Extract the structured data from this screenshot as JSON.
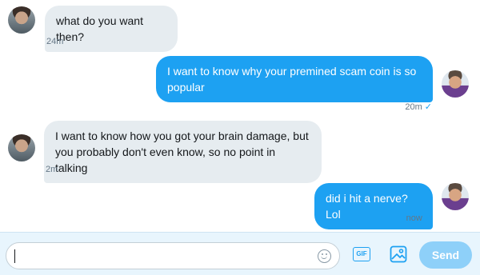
{
  "messages": [
    {
      "direction": "incoming",
      "text": "what do you want then?",
      "time": "24m"
    },
    {
      "direction": "outgoing",
      "text": "I want to know why your premined scam coin is so popular",
      "time": "20m",
      "status": "✓"
    },
    {
      "direction": "incoming",
      "text": "I want to know how you got your brain damage, but you probably don't even know, so no point in talking",
      "time": "2m"
    },
    {
      "direction": "outgoing",
      "text": "did i hit a nerve? Lol",
      "time": "now",
      "status": "✓"
    }
  ],
  "composer": {
    "value": "",
    "gif_label": "GIF",
    "send_label": "Send",
    "emoji_icon": "emoji-icon",
    "image_icon": "image-icon"
  },
  "colors": {
    "accent": "#1da1f2",
    "incoming_bubble": "#e6ecf0",
    "send_disabled": "#8ed0f9",
    "composer_bg": "#e8f5fd"
  }
}
